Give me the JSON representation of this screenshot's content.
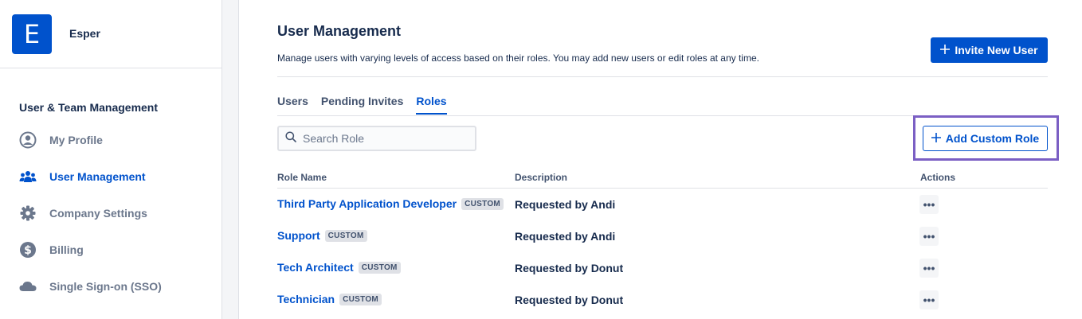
{
  "sidebar": {
    "brand": {
      "logo_letter": "E",
      "name": "Esper"
    },
    "section_heading": "User & Team Management",
    "items": [
      {
        "label": "My Profile",
        "icon": "user-circle-icon",
        "active": false
      },
      {
        "label": "User Management",
        "icon": "users-icon",
        "active": true
      },
      {
        "label": "Company Settings",
        "icon": "gear-icon",
        "active": false
      },
      {
        "label": "Billing",
        "icon": "dollar-icon",
        "active": false
      },
      {
        "label": "Single Sign-on (SSO)",
        "icon": "cloud-icon",
        "active": false
      }
    ]
  },
  "header": {
    "title": "User Management",
    "subtitle": "Manage users with varying levels of access based on their roles. You may add new users or edit roles at any time.",
    "invite_button": "Invite New User"
  },
  "tabs": [
    {
      "label": "Users",
      "active": false
    },
    {
      "label": "Pending Invites",
      "active": false
    },
    {
      "label": "Roles",
      "active": true
    }
  ],
  "search": {
    "placeholder": "Search Role",
    "value": ""
  },
  "add_button": "Add Custom Role",
  "table": {
    "columns": [
      "Role Name",
      "Description",
      "Actions"
    ],
    "rows": [
      {
        "name": "Third Party Application Developer",
        "badge": "CUSTOM",
        "description": "Requested by Andi",
        "action": "•••"
      },
      {
        "name": "Support",
        "badge": "CUSTOM",
        "description": "Requested by Andi",
        "action": "•••"
      },
      {
        "name": "Tech Architect",
        "badge": "CUSTOM",
        "description": "Requested by Donut",
        "action": "•••"
      },
      {
        "name": "Technician",
        "badge": "CUSTOM",
        "description": "Requested by Donut",
        "action": "•••"
      }
    ]
  },
  "colors": {
    "primary": "#0052cc",
    "highlight": "#7b5fc4",
    "muted": "#6b778c"
  }
}
